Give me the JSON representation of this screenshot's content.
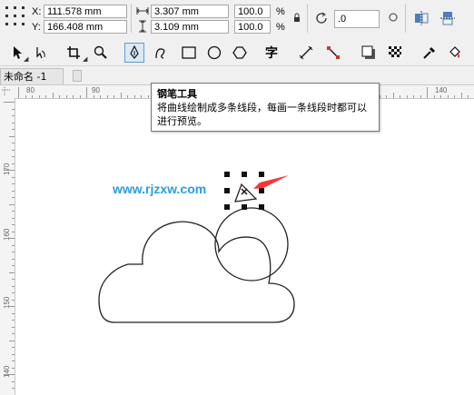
{
  "property_bar": {
    "x_label": "X:",
    "x_value": "111.578 mm",
    "y_label": "Y:",
    "y_value": "166.408 mm",
    "width_value": "3.307 mm",
    "height_value": "3.109 mm",
    "scale_x": "100.0",
    "scale_y": "100.0",
    "percent_sign": "%",
    "rotation_value": ".0"
  },
  "document": {
    "tab_label": "未命名 -1"
  },
  "tooltip": {
    "title": "钢笔工具",
    "description": "将曲线绘制成多条线段，每画一条线段时都可以进行预览。"
  },
  "watermark": "www.rjzxw.com",
  "rulers": {
    "h_labels": [
      "80",
      "90",
      "140"
    ],
    "v_labels": [
      "170",
      "160",
      "150",
      "140"
    ]
  },
  "colors": {
    "accent": "#5b9bd5",
    "watermark": "#2a9de0",
    "arrow": "#ff3333"
  },
  "icons": [
    "pick-tool-icon",
    "shape-tool-icon",
    "crop-tool-icon",
    "zoom-tool-icon",
    "pen-tool-icon",
    "freehand-tool-icon",
    "rectangle-tool-icon",
    "ellipse-tool-icon",
    "polygon-tool-icon",
    "text-tool-icon",
    "parallel-dimension-tool-icon",
    "connector-tool-icon",
    "drop-shadow-tool-icon",
    "transparency-tool-icon",
    "eyedropper-tool-icon",
    "fill-tool-icon"
  ]
}
